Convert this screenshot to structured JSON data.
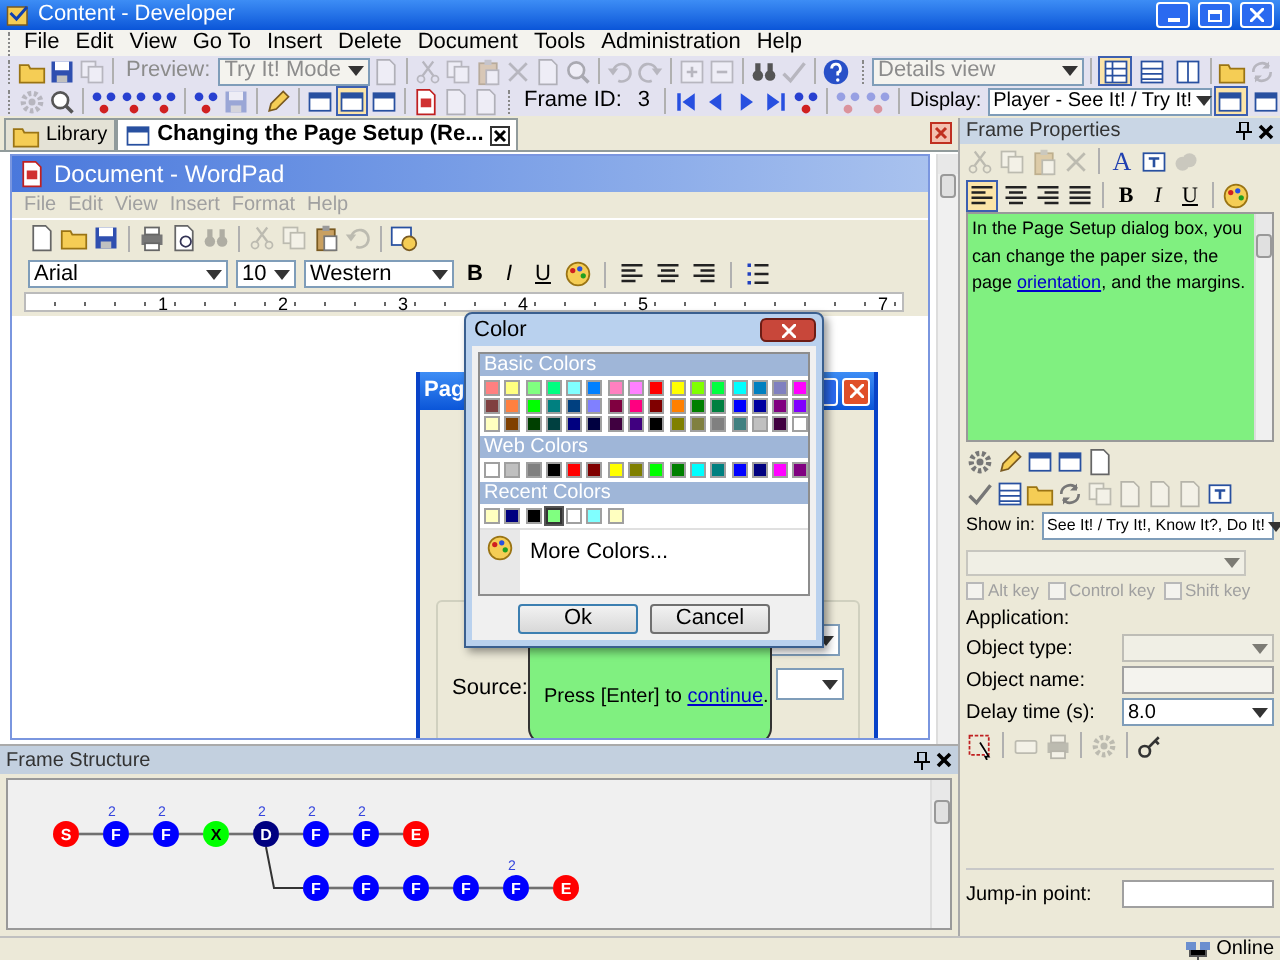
{
  "window": {
    "title": "Content - Developer"
  },
  "menu": [
    "File",
    "Edit",
    "View",
    "Go To",
    "Insert",
    "Delete",
    "Document",
    "Tools",
    "Administration",
    "Help"
  ],
  "toolbar": {
    "preview_label": "Preview:",
    "mode": "Try It! Mode",
    "view": "Details view",
    "view_modes": [
      {
        "selected": true
      },
      {
        "selected": false
      },
      {
        "selected": false
      }
    ],
    "frame_id_label": "Frame ID:",
    "frame_id": "3",
    "display_label": "Display:",
    "display": "Player - See It! / Try It!",
    "display_modes": [
      {
        "selected": true
      },
      {
        "selected": false
      }
    ]
  },
  "tabs": [
    {
      "label": "Library",
      "selected": false
    },
    {
      "label": "Changing the Page Setup (Re...",
      "selected": true
    }
  ],
  "wordpad": {
    "title": "Document - WordPad",
    "menu": [
      "File",
      "Edit",
      "View",
      "Insert",
      "Format",
      "Help"
    ],
    "font": "Arial",
    "size": "10",
    "script": "Western",
    "style_buttons": [
      "B",
      "I",
      "U"
    ],
    "ruler": [
      "1",
      "2",
      "3",
      "4",
      "5",
      "7"
    ]
  },
  "page_setup": {
    "title": "Pag",
    "source_label": "Source:",
    "callout_text": "Press [Enter] to ",
    "callout_link": "continue",
    "callout_end": "."
  },
  "color_dialog": {
    "title": "Color",
    "basic_label": "Basic Colors",
    "basic": [
      {
        "color": "#ff8080"
      },
      {
        "color": "#ffff80"
      },
      {
        "color": "#80ff80"
      },
      {
        "color": "#00ff80"
      },
      {
        "color": "#80ffff"
      },
      {
        "color": "#0080ff"
      },
      {
        "color": "#ff80c0"
      },
      {
        "color": "#ff80ff"
      },
      {
        "color": "#ff0000"
      },
      {
        "color": "#ffff00"
      },
      {
        "color": "#80ff00"
      },
      {
        "color": "#00ff40"
      },
      {
        "color": "#00ffff"
      },
      {
        "color": "#0080c0"
      },
      {
        "color": "#8080c0"
      },
      {
        "color": "#ff00ff"
      },
      {
        "color": "#804040"
      },
      {
        "color": "#ff8040"
      },
      {
        "color": "#00ff00"
      },
      {
        "color": "#008080"
      },
      {
        "color": "#004080"
      },
      {
        "color": "#8080ff"
      },
      {
        "color": "#800040"
      },
      {
        "color": "#ff0080"
      },
      {
        "color": "#800000"
      },
      {
        "color": "#ff8000"
      },
      {
        "color": "#008000"
      },
      {
        "color": "#008040"
      },
      {
        "color": "#0000ff"
      },
      {
        "color": "#0000a0"
      },
      {
        "color": "#800080"
      },
      {
        "color": "#8000ff"
      },
      {
        "color": "#ffffc0"
      },
      {
        "color": "#804000"
      },
      {
        "color": "#004000"
      },
      {
        "color": "#004040"
      },
      {
        "color": "#000080"
      },
      {
        "color": "#000040"
      },
      {
        "color": "#400040"
      },
      {
        "color": "#400080"
      },
      {
        "color": "#000000"
      },
      {
        "color": "#808000"
      },
      {
        "color": "#808040"
      },
      {
        "color": "#808080"
      },
      {
        "color": "#408080"
      },
      {
        "color": "#c0c0c0"
      },
      {
        "color": "#400040"
      },
      {
        "color": "#ffffff"
      }
    ],
    "web_label": "Web Colors",
    "web": [
      {
        "color": "#ffffff"
      },
      {
        "color": "#c0c0c0"
      },
      {
        "color": "#808080"
      },
      {
        "color": "#000000"
      },
      {
        "color": "#ff0000"
      },
      {
        "color": "#800000"
      },
      {
        "color": "#ffff00"
      },
      {
        "color": "#808000"
      },
      {
        "color": "#00ff00"
      },
      {
        "color": "#008000"
      },
      {
        "color": "#00ffff"
      },
      {
        "color": "#008080"
      },
      {
        "color": "#0000ff"
      },
      {
        "color": "#000080"
      },
      {
        "color": "#ff00ff"
      },
      {
        "color": "#800080"
      }
    ],
    "recent_label": "Recent Colors",
    "recent": [
      {
        "color": "#ffffc0",
        "selected": false
      },
      {
        "color": "#000080",
        "selected": false
      },
      {
        "color": "#000000",
        "selected": false
      },
      {
        "color": "#80ff80",
        "selected": true
      },
      {
        "color": "#ffffff",
        "selected": false
      },
      {
        "color": "#80ffff",
        "selected": false
      },
      {
        "color": "#ffffc0",
        "selected": false
      }
    ],
    "more": "More Colors...",
    "ok": "Ok",
    "cancel": "Cancel"
  },
  "frame_structure": {
    "title": "Frame Structure",
    "nodes": [
      {
        "label": "S",
        "color": "#ff0000"
      },
      {
        "label": "F",
        "color": "#0000ff",
        "badge": "2"
      },
      {
        "label": "F",
        "color": "#0000ff",
        "badge": "2"
      },
      {
        "label": "X",
        "color": "#00ff00"
      },
      {
        "label": "D",
        "color": "#000080",
        "badge": "2",
        "children": [
          {
            "label": "F",
            "color": "#0000ff"
          },
          {
            "label": "F",
            "color": "#0000ff"
          },
          {
            "label": "F",
            "color": "#0000ff"
          },
          {
            "label": "F",
            "color": "#0000ff"
          },
          {
            "label": "F",
            "color": "#0000ff",
            "badge": "2"
          },
          {
            "label": "E",
            "color": "#ff0000"
          }
        ]
      },
      {
        "label": "F",
        "color": "#0000ff",
        "badge": "2"
      },
      {
        "label": "F",
        "color": "#0000ff",
        "badge": "2"
      },
      {
        "label": "E",
        "color": "#ff0000"
      }
    ]
  },
  "frame_properties": {
    "title": "Frame Properties",
    "font_button": "A",
    "style_buttons": [
      "B",
      "I",
      "U"
    ],
    "text_before": "In the Page Setup dialog box, you can change the paper size, the page ",
    "text_link": "orientation",
    "text_after": ", and the margins.",
    "show_in_label": "Show in:",
    "show_in": "See It! / Try It!, Know It?, Do It!",
    "checkboxes": [
      {
        "label": "Alt key",
        "checked": false,
        "disabled": true
      },
      {
        "label": "Control key",
        "checked": false,
        "disabled": true
      },
      {
        "label": "Shift key",
        "checked": false,
        "disabled": true
      }
    ],
    "application_label": "Application:",
    "object_type_label": "Object type:",
    "object_name_label": "Object name:",
    "delay_label": "Delay time (s):",
    "delay": "8.0",
    "jump_label": "Jump-in point:"
  },
  "status_bar": {
    "status": "Online"
  }
}
